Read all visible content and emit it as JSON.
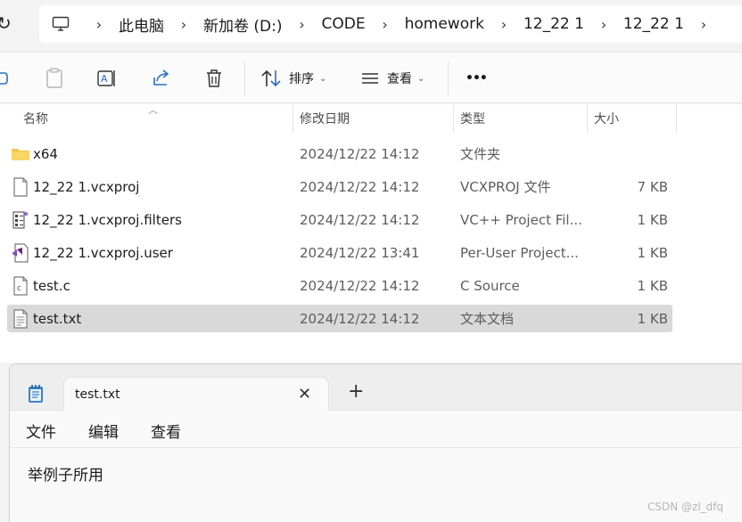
{
  "address_bar": {
    "refresh_icon": "refresh-icon",
    "pc_icon": "computer-icon",
    "crumbs": [
      "此电脑",
      "新加卷 (D:)",
      "CODE",
      "homework",
      "12_22 1",
      "12_22 1"
    ]
  },
  "toolbar": {
    "sort_label": "排序",
    "view_label": "查看",
    "more_label": "•••"
  },
  "file_list": {
    "columns": [
      "名称",
      "修改日期",
      "类型",
      "大小"
    ],
    "rows": [
      {
        "name": "x64",
        "date": "2024/12/22 14:12",
        "type": "文件夹",
        "size": "",
        "icon": "folder-icon"
      },
      {
        "name": "12_22 1.vcxproj",
        "date": "2024/12/22 14:12",
        "type": "VCXPROJ 文件",
        "size": "7 KB",
        "icon": "file-icon"
      },
      {
        "name": "12_22 1.vcxproj.filters",
        "date": "2024/12/22 14:12",
        "type": "VC++ Project Fil...",
        "size": "1 KB",
        "icon": "filters-file-icon"
      },
      {
        "name": "12_22 1.vcxproj.user",
        "date": "2024/12/22 13:41",
        "type": "Per-User Project...",
        "size": "1 KB",
        "icon": "visual-studio-file-icon"
      },
      {
        "name": "test.c",
        "date": "2024/12/22 14:12",
        "type": "C Source",
        "size": "1 KB",
        "icon": "c-source-file-icon"
      },
      {
        "name": "test.txt",
        "date": "2024/12/22 14:12",
        "type": "文本文档",
        "size": "1 KB",
        "icon": "text-file-icon",
        "selected": true
      }
    ]
  },
  "notepad": {
    "tab_title": "test.txt",
    "close_glyph": "✕",
    "new_tab_glyph": "+",
    "menu": [
      "文件",
      "编辑",
      "查看"
    ],
    "content": "举例子所用"
  },
  "watermark": "CSDN @zl_dfq",
  "colors": {
    "selected_row": "#d9d9d9",
    "folder": "#f4c44e",
    "notepad_icon": "#3a84c9"
  }
}
